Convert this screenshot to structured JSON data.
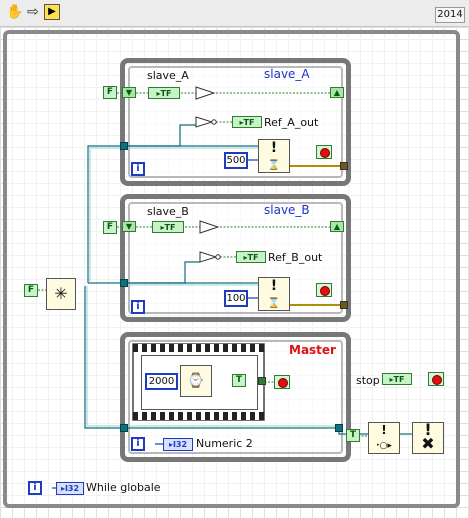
{
  "toolbar": {
    "version": "2014",
    "icons": [
      "hand-icon",
      "arrow-right-icon",
      "run-icon"
    ]
  },
  "slave_a": {
    "title": "slave_A",
    "global_name": "slave_A",
    "ref_out": "Ref_A_out",
    "wait_ms": "500",
    "const": "F"
  },
  "slave_b": {
    "title": "slave_B",
    "global_name": "slave_B",
    "ref_out": "Ref_B_out",
    "wait_ms": "100",
    "const": "F"
  },
  "master": {
    "title": "Master",
    "wait_ms": "2000",
    "numeric_label": "Numeric 2",
    "const_t": "T"
  },
  "stop": {
    "label": "stop",
    "const_t": "T"
  },
  "outer": {
    "label": "While globale",
    "const_f": "F"
  },
  "tags": {
    "tf": "TF",
    "i32": "I32",
    "iter": "i"
  },
  "colors": {
    "boolean": "#2e7d32",
    "numeric_int": "#1f3bbf",
    "refnum": "#0d7080",
    "title_blue": "#1b33c9",
    "title_red": "#e01010"
  }
}
